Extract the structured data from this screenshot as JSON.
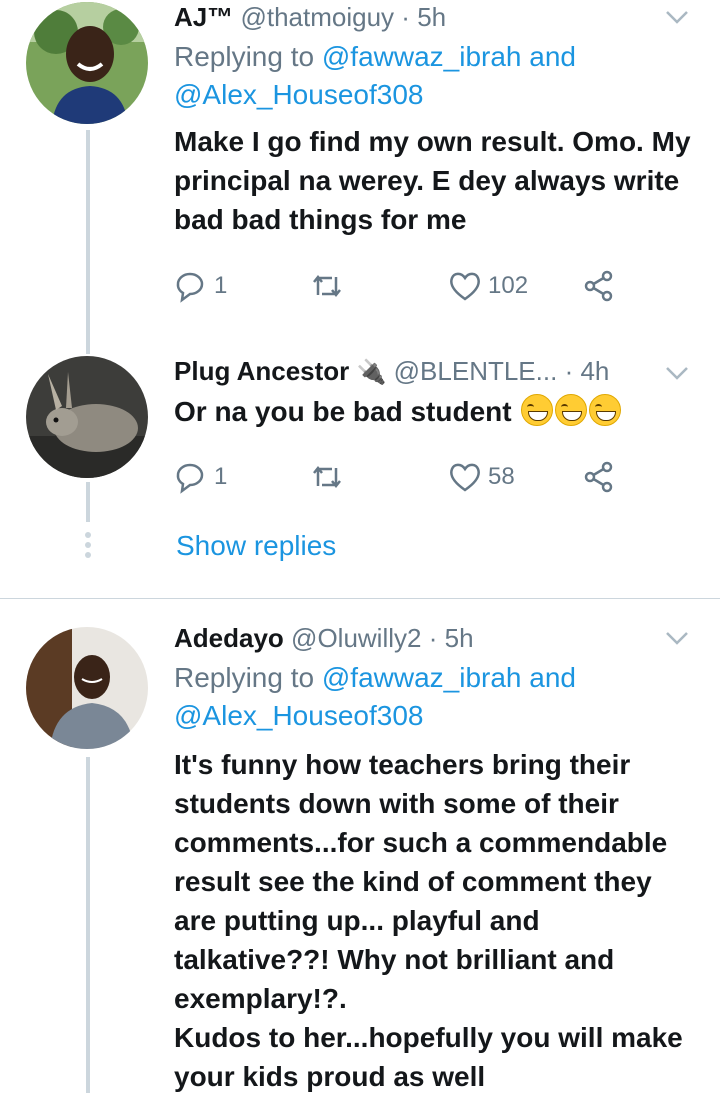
{
  "tweets": [
    {
      "name": "AJ™",
      "handle": "@thatmoiguy",
      "dot": "·",
      "time": "5h",
      "replying_prefix": "Replying to",
      "mention1": "@fawwaz_ibrah",
      "and": "and",
      "mention2": "@Alex_Houseof308",
      "text_lines": [
        "Make I go find my own result. Omo. My",
        "principal na werey. E dey always write",
        "bad bad things for me"
      ],
      "replies": "1",
      "likes": "102"
    },
    {
      "name": "Plug Ancestor",
      "name_emoji": "🔌",
      "handle": "@BLENTLE...",
      "dot": "·",
      "time": "4h",
      "text": "Or na you be bad student",
      "emojis": [
        "grinning-squinting-face-emoji",
        "grinning-squinting-face-emoji",
        "grinning-squinting-face-emoji"
      ],
      "replies": "1",
      "likes": "58"
    },
    {
      "name": "Adedayo",
      "handle": "@Oluwilly2",
      "dot": "·",
      "time": "5h",
      "replying_prefix": "Replying to",
      "mention1": "@fawwaz_ibrah",
      "and": "and",
      "mention2": "@Alex_Houseof308",
      "text_lines": [
        "It's funny how teachers bring their",
        "students down with some of their",
        "comments...for such a commendable",
        "result see the kind of comment they",
        "are putting up... playful and",
        "talkative??! Why not brilliant and",
        "exemplary!?.",
        "Kudos to her...hopefully you will make",
        "your kids proud as well"
      ]
    }
  ],
  "show_replies": "Show replies",
  "icons": [
    "reply-icon",
    "retweet-icon",
    "like-icon",
    "share-icon",
    "chevron-down-icon"
  ],
  "colors": {
    "link": "#1b95e0",
    "muted": "#657786",
    "line": "#ccd6dd"
  }
}
